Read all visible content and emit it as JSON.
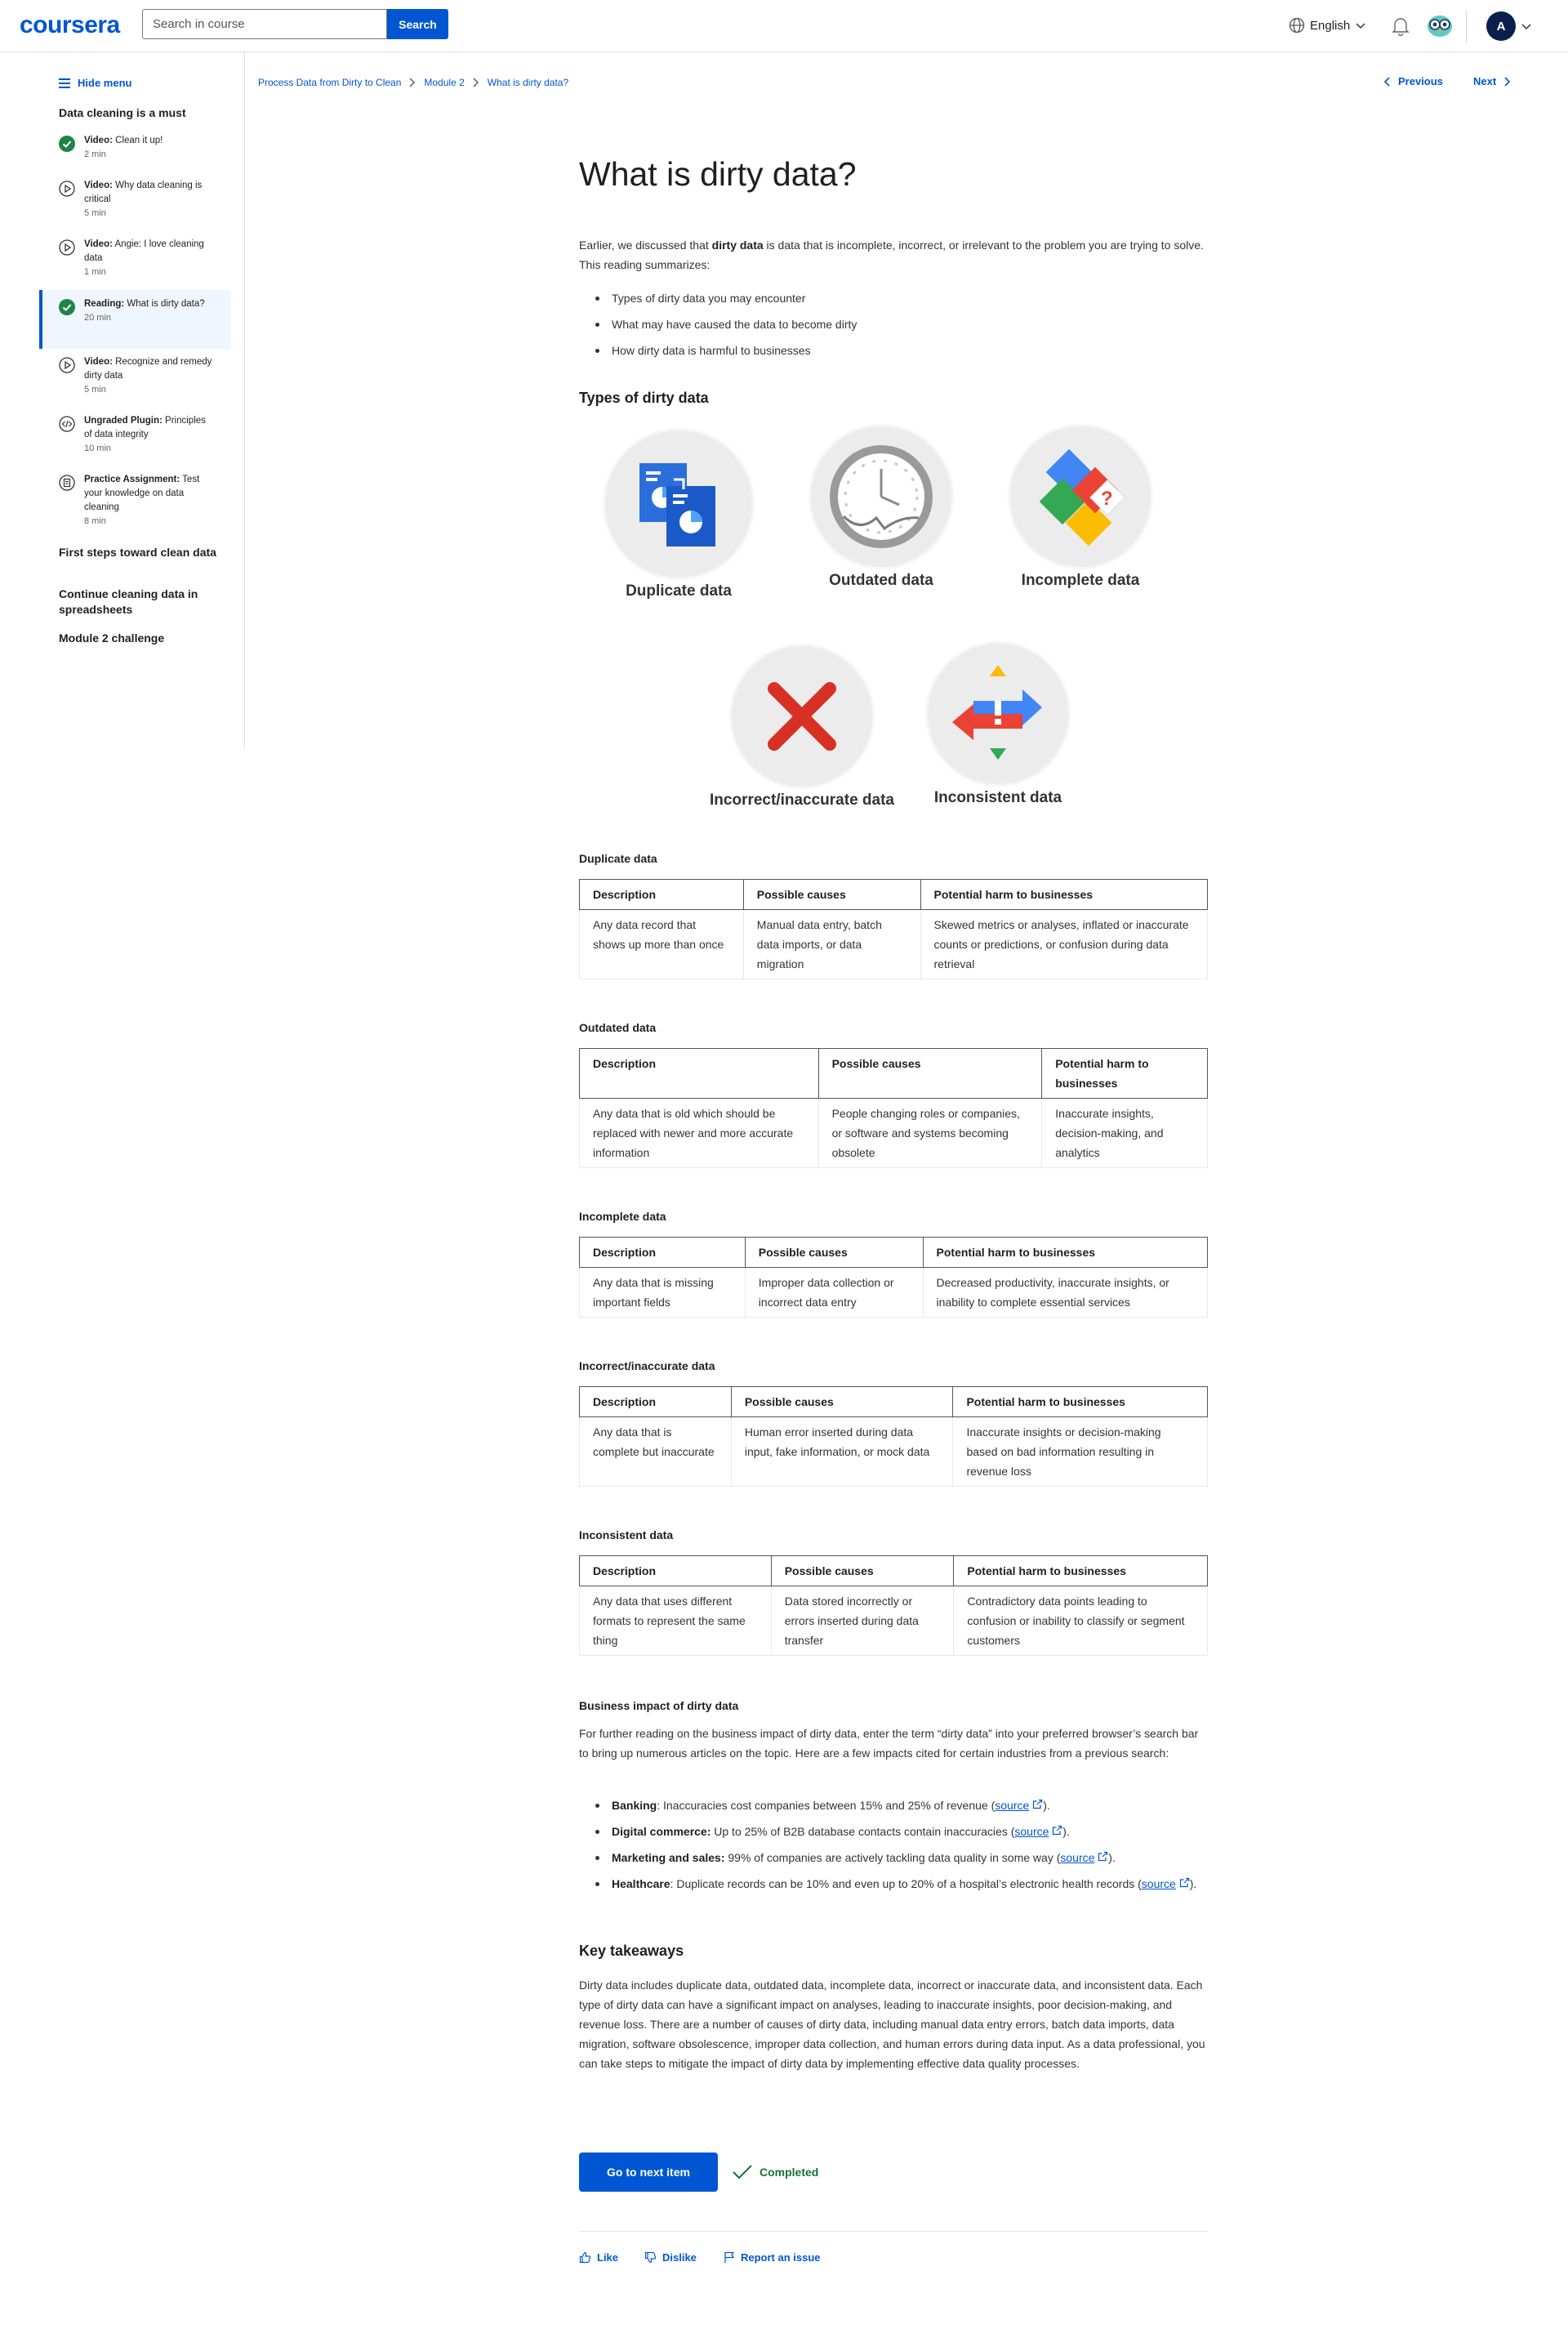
{
  "header": {
    "logo": "coursera",
    "search_placeholder": "Search in course",
    "search_button": "Search",
    "language": "English",
    "avatar_initial": "A"
  },
  "sidebar": {
    "hide_menu": "Hide menu",
    "module_title": "Data cleaning is a must",
    "items": [
      {
        "type": "Video:",
        "title": "Clean it up!",
        "duration": "2 min",
        "status": "completed"
      },
      {
        "type": "Video:",
        "title": "Why data cleaning is critical",
        "duration": "5 min",
        "status": "video"
      },
      {
        "type": "Video:",
        "title": "Angie: I love cleaning data",
        "duration": "1 min",
        "status": "video"
      },
      {
        "type": "Reading:",
        "title": "What is dirty data?",
        "duration": "20 min",
        "status": "completed"
      },
      {
        "type": "Video:",
        "title": "Recognize and remedy dirty data",
        "duration": "5 min",
        "status": "video"
      },
      {
        "type": "Ungraded Plugin:",
        "title": "Principles of data integrity",
        "duration": "10 min",
        "status": "plugin"
      },
      {
        "type": "Practice Assignment:",
        "title": "Test your knowledge on data cleaning",
        "duration": "8 min",
        "status": "assignment"
      }
    ],
    "sections": [
      "First steps toward clean data",
      "Continue cleaning data in spreadsheets",
      "Module 2 challenge"
    ]
  },
  "breadcrumbs": [
    "Process Data from Dirty to Clean",
    "Module 2",
    "What is dirty data?"
  ],
  "nav": {
    "previous": "Previous",
    "next": "Next"
  },
  "main": {
    "title": "What is dirty data?",
    "intro_pre": "Earlier, we discussed that ",
    "intro_bold": "dirty data",
    "intro_post": " is data that is incomplete, incorrect, or irrelevant to the problem you are trying to solve.  This reading summarizes:",
    "summary_bullets": [
      "Types of dirty data you may encounter",
      "What may have caused the data to become dirty",
      "How dirty data is harmful to businesses"
    ],
    "types_heading": "Types of dirty data",
    "illustrations": [
      "Duplicate data",
      "Outdated data",
      "Incomplete data",
      "Incorrect/inaccurate data",
      "Inconsistent data"
    ],
    "tables": [
      {
        "title": "Duplicate data",
        "headers": [
          "Description",
          "Possible causes",
          "Potential harm to businesses"
        ],
        "row": [
          "Any data record that shows up more than once",
          "Manual data entry, batch data imports, or data migration",
          "Skewed metrics or analyses, inflated or inaccurate counts or predictions, or confusion during data retrieval"
        ]
      },
      {
        "title": "Outdated data",
        "headers": [
          "Description",
          "Possible causes",
          "Potential harm to businesses"
        ],
        "row": [
          "Any data that is old which should be replaced with newer and more accurate information",
          "People changing roles or companies, or software and systems becoming obsolete",
          "Inaccurate insights, decision-making, and analytics"
        ]
      },
      {
        "title": "Incomplete data",
        "headers": [
          "Description",
          "Possible causes",
          "Potential harm to businesses"
        ],
        "row": [
          "Any data that is missing important fields",
          "Improper data collection or incorrect data entry",
          "Decreased productivity, inaccurate insights, or inability to complete essential services"
        ]
      },
      {
        "title": "Incorrect/inaccurate data",
        "headers": [
          "Description",
          "Possible causes",
          "Potential harm to businesses"
        ],
        "row": [
          "Any data that is complete but inaccurate",
          "Human error inserted during data input, fake information, or mock data",
          "Inaccurate insights or decision-making based on bad information resulting in revenue loss"
        ]
      },
      {
        "title": "Inconsistent data",
        "headers": [
          "Description",
          "Possible causes",
          "Potential harm to businesses"
        ],
        "row": [
          "Any data that uses different formats to represent the same thing",
          "Data stored incorrectly or errors inserted during data transfer",
          "Contradictory data points leading to confusion or inability to classify or segment customers"
        ]
      }
    ],
    "impact_heading": "Business impact of dirty data",
    "impact_intro": "For further reading on the business impact of dirty data, enter the term “dirty data” into your preferred browser’s search bar to bring up numerous articles on the topic. Here are a few impacts cited for certain industries from a previous search:",
    "impacts": [
      {
        "label": "Banking",
        "text": ": Inaccuracies cost companies between 15% and 25% of revenue (",
        "link": "source",
        "end": ")."
      },
      {
        "label": "Digital commerce:",
        "text": " Up to 25% of B2B database contacts contain inaccuracies (",
        "link": "source",
        "end": ")."
      },
      {
        "label": "Marketing and sales:",
        "text": " 99% of companies are actively tackling data quality in some way (",
        "link": "source",
        "end": ")."
      },
      {
        "label": "Healthcare",
        "text": ": Duplicate records can be 10% and even up to 20% of a hospital’s electronic health records (",
        "link": "source",
        "end": ")."
      }
    ],
    "takeaways_heading": "Key takeaways",
    "takeaways": "Dirty data includes duplicate data, outdated data, incomplete data, incorrect or inaccurate data, and inconsistent data. Each type of dirty data can have a significant impact on analyses, leading to inaccurate insights, poor decision-making, and revenue loss. There are a number of causes of dirty data, including manual data entry errors, batch data imports, data migration, software obsolescence, improper data collection, and human errors during data input. As a data professional, you can take steps to mitigate the impact of dirty data by implementing effective data quality processes.",
    "next_button": "Go to next item",
    "completed": "Completed",
    "feedback": {
      "like": "Like",
      "dislike": "Dislike",
      "report": "Report an issue"
    }
  },
  "colors": {
    "brand": "#0056d2",
    "success": "#137333",
    "active_bg": "#f0f6ff"
  }
}
